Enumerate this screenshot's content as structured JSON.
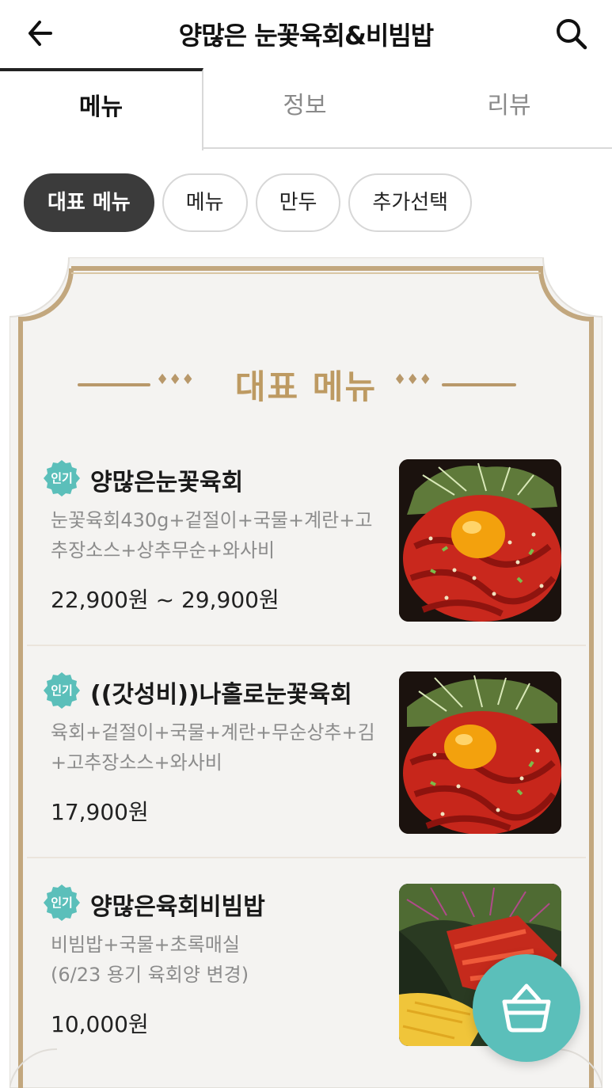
{
  "header": {
    "title": "양많은 눈꽃육회&비빔밥",
    "back_icon": "arrow-left-icon",
    "search_icon": "search-icon"
  },
  "tabs": [
    {
      "label": "메뉴",
      "active": true
    },
    {
      "label": "정보",
      "active": false
    },
    {
      "label": "리뷰",
      "active": false
    }
  ],
  "categories": [
    {
      "label": "대표 메뉴",
      "active": true
    },
    {
      "label": "메뉴",
      "active": false
    },
    {
      "label": "만두",
      "active": false
    },
    {
      "label": "추가선택",
      "active": false
    }
  ],
  "section": {
    "title": "대표 메뉴",
    "diamonds": "♦♦♦"
  },
  "items": [
    {
      "badge": "인기",
      "name": "양많은눈꽃육회",
      "desc_line1": "눈꽃육회430g+겉절이+국물+계란+고",
      "desc_line2": "추장소스+상추무순+와사비",
      "price": "22,900원 ~ 29,900원"
    },
    {
      "badge": "인기",
      "name": "((갓성비))나홀로눈꽃육회",
      "desc_line1": "육회+겉절이+국물+계란+무순상추+김",
      "desc_line2": "+고추장소스+와사비",
      "price": "17,900원"
    },
    {
      "badge": "인기",
      "name": "양많은육회비빔밥",
      "desc_line1": "비빔밥+국물+초록매실",
      "desc_line2": "(6/23 용기 육회양 변경)",
      "price": "10,000원"
    }
  ],
  "cart": {
    "icon": "shopping-basket-icon"
  },
  "colors": {
    "accent_teal": "#5bbfba",
    "gold": "#bd9a62",
    "chip_active": "#3b3b3b"
  }
}
